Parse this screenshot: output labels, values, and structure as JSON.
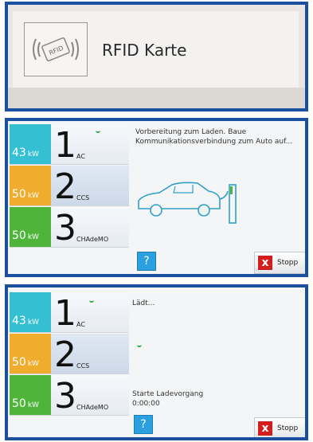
{
  "rfid_panel": {
    "label": "RFID Karte",
    "icon": "rfid-card-icon",
    "icon_text": "RFID"
  },
  "colors": {
    "frame": "#1b4fa0",
    "kw_ac": "#35bfd2",
    "kw_ccs": "#f0ad2d",
    "kw_chademo": "#4fb53a",
    "stop_x": "#d41d1d",
    "help": "#2aa0e0",
    "car_outline": "#2fa1c9"
  },
  "connectors": [
    {
      "number": "1",
      "kw": "43",
      "unit": "kW",
      "type": "AC",
      "color": "#35bfd2"
    },
    {
      "number": "2",
      "kw": "50",
      "unit": "kW",
      "type": "CCS",
      "color": "#f0ad2d"
    },
    {
      "number": "3",
      "kw": "50",
      "unit": "kW",
      "type": "CHAdeMO",
      "color": "#4fb53a"
    }
  ],
  "screen1": {
    "status": "Vorbereitung zum Laden. Baue Kommunikationsverbindung zum Auto auf...",
    "help_label": "?",
    "stop_label": "Stopp",
    "stop_icon": "x"
  },
  "screen2": {
    "status": "Lädt...",
    "process_label": "Starte Ladevorgang",
    "timer": "0:00:00",
    "help_label": "?",
    "stop_label": "Stopp",
    "stop_icon": "x"
  }
}
